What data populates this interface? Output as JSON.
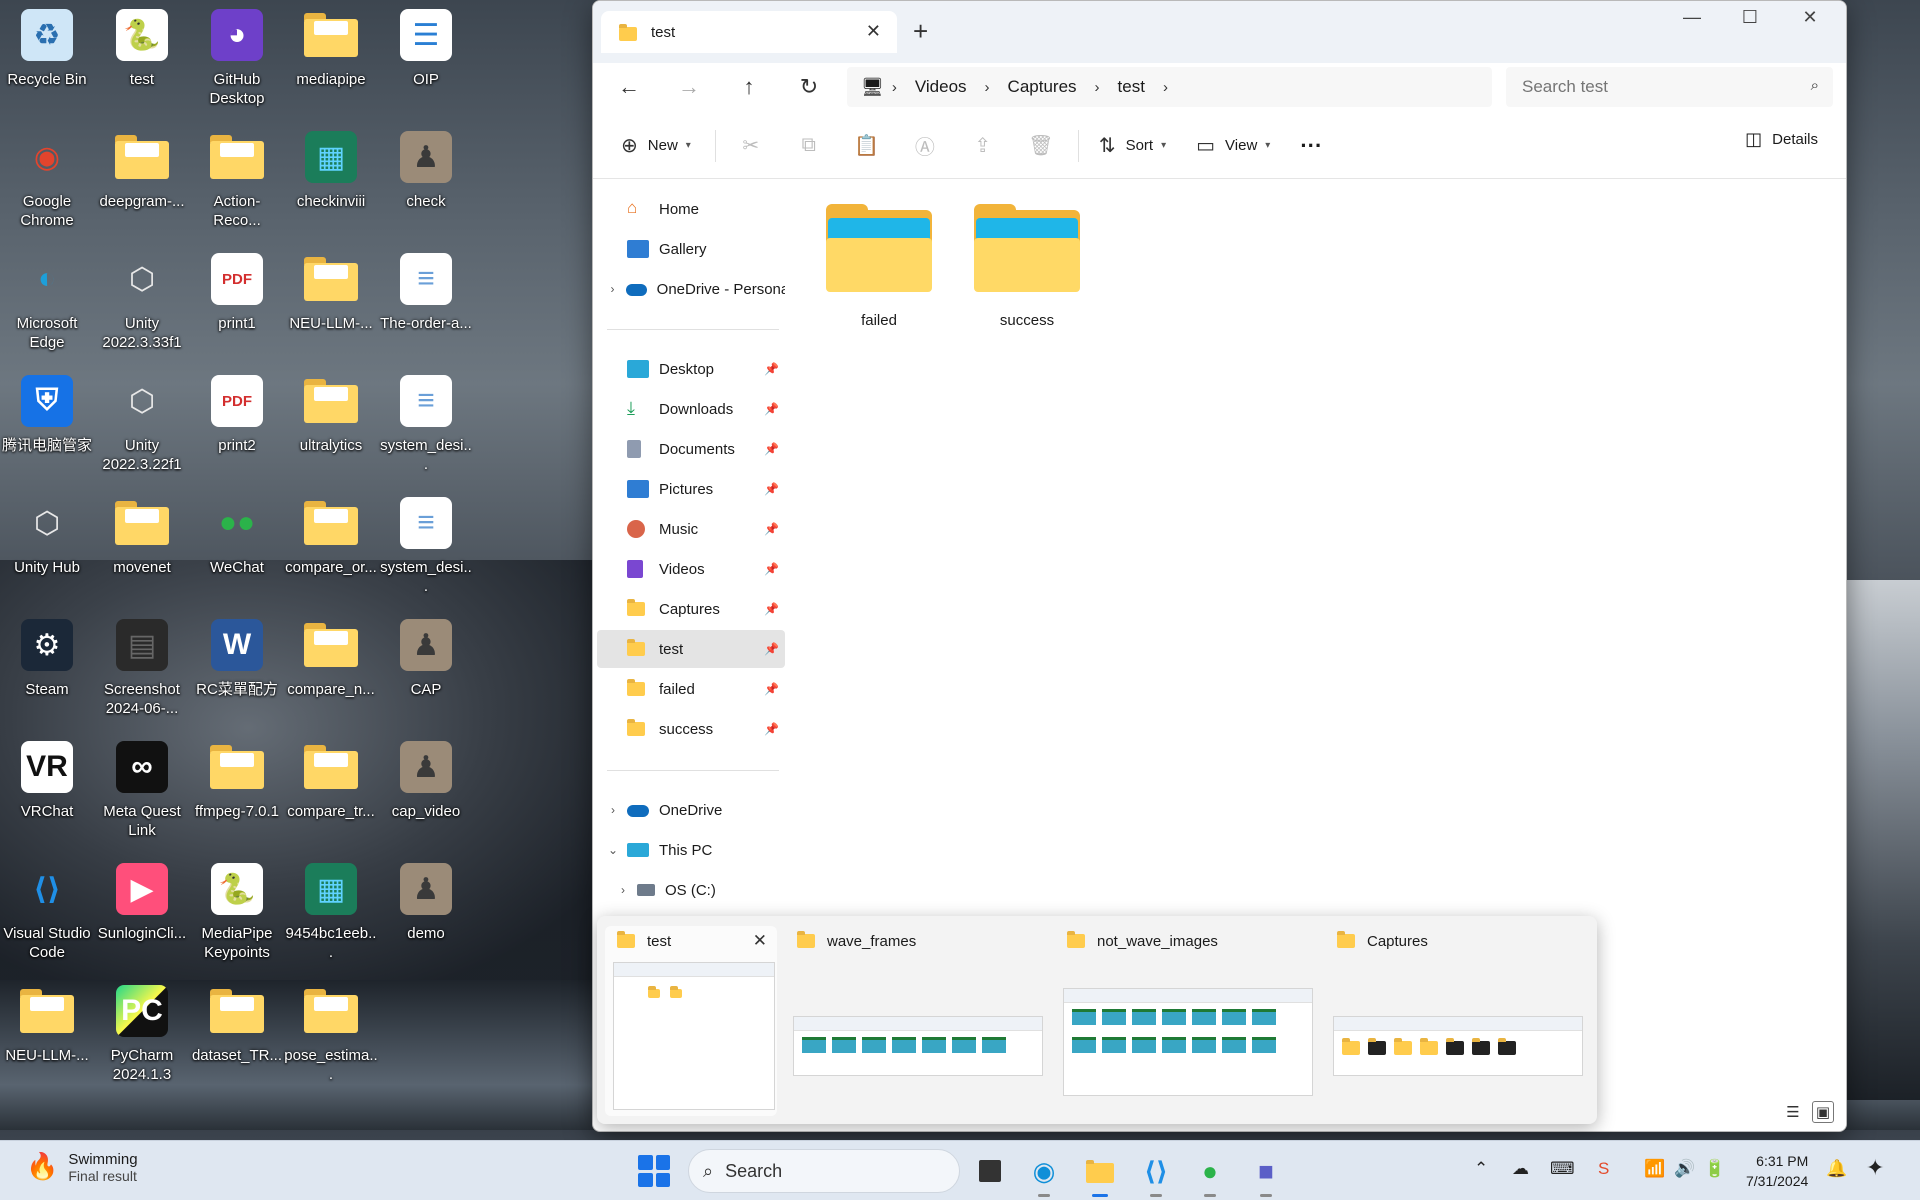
{
  "desktop": {
    "icons": [
      {
        "label": "Recycle Bin"
      },
      {
        "label": "test"
      },
      {
        "label": "GitHub Desktop"
      },
      {
        "label": "mediapipe"
      },
      {
        "label": "OIP"
      },
      {
        "label": "Google Chrome"
      },
      {
        "label": "deepgram-..."
      },
      {
        "label": "Action-Reco..."
      },
      {
        "label": "checkinviii"
      },
      {
        "label": "check"
      },
      {
        "label": "Microsoft Edge"
      },
      {
        "label": "Unity 2022.3.33f1"
      },
      {
        "label": "print1"
      },
      {
        "label": "NEU-LLM-..."
      },
      {
        "label": "The-order-a..."
      },
      {
        "label": "腾讯电脑管家"
      },
      {
        "label": "Unity 2022.3.22f1"
      },
      {
        "label": "print2"
      },
      {
        "label": "ultralytics"
      },
      {
        "label": "system_desi..."
      },
      {
        "label": "Unity Hub"
      },
      {
        "label": "movenet"
      },
      {
        "label": "WeChat"
      },
      {
        "label": "compare_or..."
      },
      {
        "label": "system_desi..."
      },
      {
        "label": "Steam"
      },
      {
        "label": "Screenshot 2024-06-..."
      },
      {
        "label": "RC菜單配方"
      },
      {
        "label": "compare_n..."
      },
      {
        "label": "CAP"
      },
      {
        "label": "VRChat"
      },
      {
        "label": "Meta Quest Link"
      },
      {
        "label": "ffmpeg-7.0.1"
      },
      {
        "label": "compare_tr..."
      },
      {
        "label": "cap_video"
      },
      {
        "label": "Visual Studio Code"
      },
      {
        "label": "SunloginCli..."
      },
      {
        "label": "MediaPipe Keypoints"
      },
      {
        "label": "9454bc1eeb..."
      },
      {
        "label": "demo"
      },
      {
        "label": "NEU-LLM-..."
      },
      {
        "label": "PyCharm 2024.1.3"
      },
      {
        "label": "dataset_TR..."
      },
      {
        "label": "pose_estima..."
      }
    ],
    "pdf_badge": "PDF",
    "vr_badge": "VR",
    "pc_badge": "PC"
  },
  "explorer": {
    "tab_title": "test",
    "breadcrumb": [
      "Videos",
      "Captures",
      "test"
    ],
    "search_placeholder": "Search test",
    "toolbar": {
      "new_label": "New",
      "sort_label": "Sort",
      "view_label": "View",
      "more_label": "···",
      "details_label": "Details"
    },
    "nav": {
      "home": "Home",
      "gallery": "Gallery",
      "onedrive_personal": "OneDrive - Personal",
      "desktop": "Desktop",
      "downloads": "Downloads",
      "documents": "Documents",
      "pictures": "Pictures",
      "music": "Music",
      "videos": "Videos",
      "captures": "Captures",
      "test": "test",
      "failed": "failed",
      "success": "success",
      "onedrive": "OneDrive",
      "this_pc": "This PC",
      "os_c": "OS (C:)"
    },
    "folders": [
      {
        "name": "failed"
      },
      {
        "name": "success"
      }
    ]
  },
  "thumbnails": [
    {
      "title": "test"
    },
    {
      "title": "wave_frames"
    },
    {
      "title": "not_wave_images"
    },
    {
      "title": "Captures"
    }
  ],
  "taskbar": {
    "weather_title": "Swimming",
    "weather_sub": "Final result",
    "search_label": "Search",
    "time": "6:31 PM",
    "date": "7/31/2024"
  },
  "colors": {
    "accent": "#1a73e8",
    "folder_yellow": "#ffd766",
    "folder_blue": "#1fb6e8"
  }
}
